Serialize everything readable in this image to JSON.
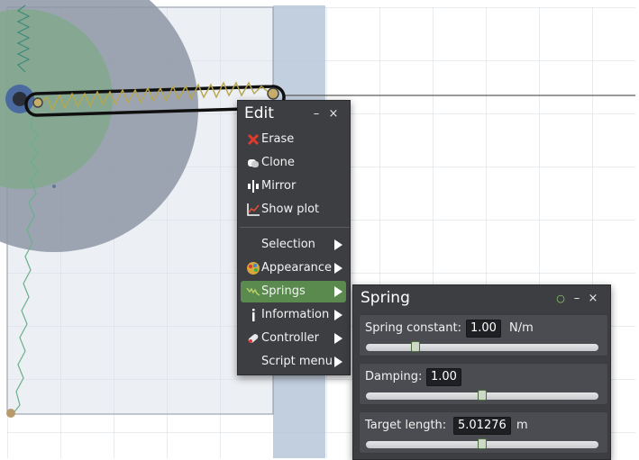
{
  "edit_menu": {
    "title": "Edit",
    "minimize": "–",
    "close": "×",
    "items": [
      {
        "label": "Erase",
        "icon": "erase-x-icon",
        "color": "#e03a2e"
      },
      {
        "label": "Clone",
        "icon": "clone-icon"
      },
      {
        "label": "Mirror",
        "icon": "mirror-icon"
      },
      {
        "label": "Show plot",
        "icon": "plot-icon"
      },
      {
        "label": "Selection",
        "icon": "none",
        "submenu": true
      },
      {
        "label": "Appearance",
        "icon": "palette-icon",
        "submenu": true
      },
      {
        "label": "Springs",
        "icon": "spring-icon",
        "submenu": true,
        "active": true
      },
      {
        "label": "Information",
        "icon": "info-icon",
        "submenu": true
      },
      {
        "label": "Controller",
        "icon": "controller-icon",
        "submenu": true
      },
      {
        "label": "Script menu",
        "icon": "none",
        "submenu": true
      }
    ]
  },
  "spring_panel": {
    "title": "Spring",
    "pin": "○",
    "minimize": "–",
    "close": "×",
    "spring_constant": {
      "label": "Spring constant:",
      "value": "1.00",
      "unit": "N/m",
      "slider_fraction": 0.2
    },
    "damping": {
      "label": "Damping:",
      "value": "1.00",
      "slider_fraction": 0.5
    },
    "target_length": {
      "label": "Target length:",
      "value": "5.01276",
      "unit": "m",
      "slider_fraction": 0.5
    }
  },
  "colors": {
    "menu_bg": "#3c3e42",
    "active_item": "#5b8a4f",
    "grid_line": "#cfd4dc",
    "disc": "#8e97a6",
    "inner_disc": "#7faa88",
    "column": "#b7c7d8"
  }
}
